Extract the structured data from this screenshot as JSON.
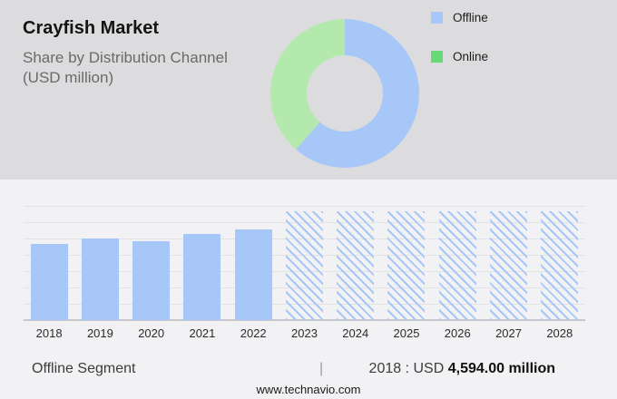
{
  "header": {
    "title": "Crayfish Market",
    "subtitle_line1": "Share by Distribution Channel",
    "subtitle_line2": "(USD million)"
  },
  "colors": {
    "header_bg": "#dcdcde",
    "body_bg": "#f2f2f4",
    "offline_blue": "#a6c7f8",
    "donut_online_green": "#b4e9ae",
    "legend_online_green": "#67da77",
    "gridline": "#e3e3e6",
    "axis": "#c8c8cc"
  },
  "chart_data": [
    {
      "type": "pie",
      "donut": true,
      "title": "Share by Distribution Channel (USD million)",
      "legend_position": "right",
      "start_angle_deg": 0,
      "slices": [
        {
          "label": "Offline",
          "share_pct": 61.4,
          "fill": "#a6c7f8",
          "legend_swatch": "#a6c7f8"
        },
        {
          "label": "Online",
          "share_pct": 38.6,
          "fill": "#b4e9ae",
          "legend_swatch": "#67da77"
        }
      ]
    },
    {
      "type": "bar",
      "categories": [
        "2018",
        "2019",
        "2020",
        "2021",
        "2022",
        "2023",
        "2024",
        "2025",
        "2026",
        "2027",
        "2028"
      ],
      "series": [
        {
          "name": "Offline",
          "values": [
            4594,
            4920,
            4760,
            5190,
            5460,
            6560,
            6560,
            6560,
            6560,
            6560,
            6560
          ]
        }
      ],
      "forecast_categories": [
        "2023",
        "2024",
        "2025",
        "2026",
        "2027",
        "2028"
      ],
      "labeled_values": {
        "2018": "USD 4,594.00 million"
      },
      "bar_fill": "#a6c7f8",
      "forecast_style": "diagonal-hatch",
      "grid": true,
      "ylabel": "",
      "xlabel": ""
    }
  ],
  "footer": {
    "segment": "Offline Segment",
    "separator": "|",
    "stat_prefix": "2018 : USD",
    "stat_value": "4,594.00 million",
    "website": "www.technavio.com"
  }
}
